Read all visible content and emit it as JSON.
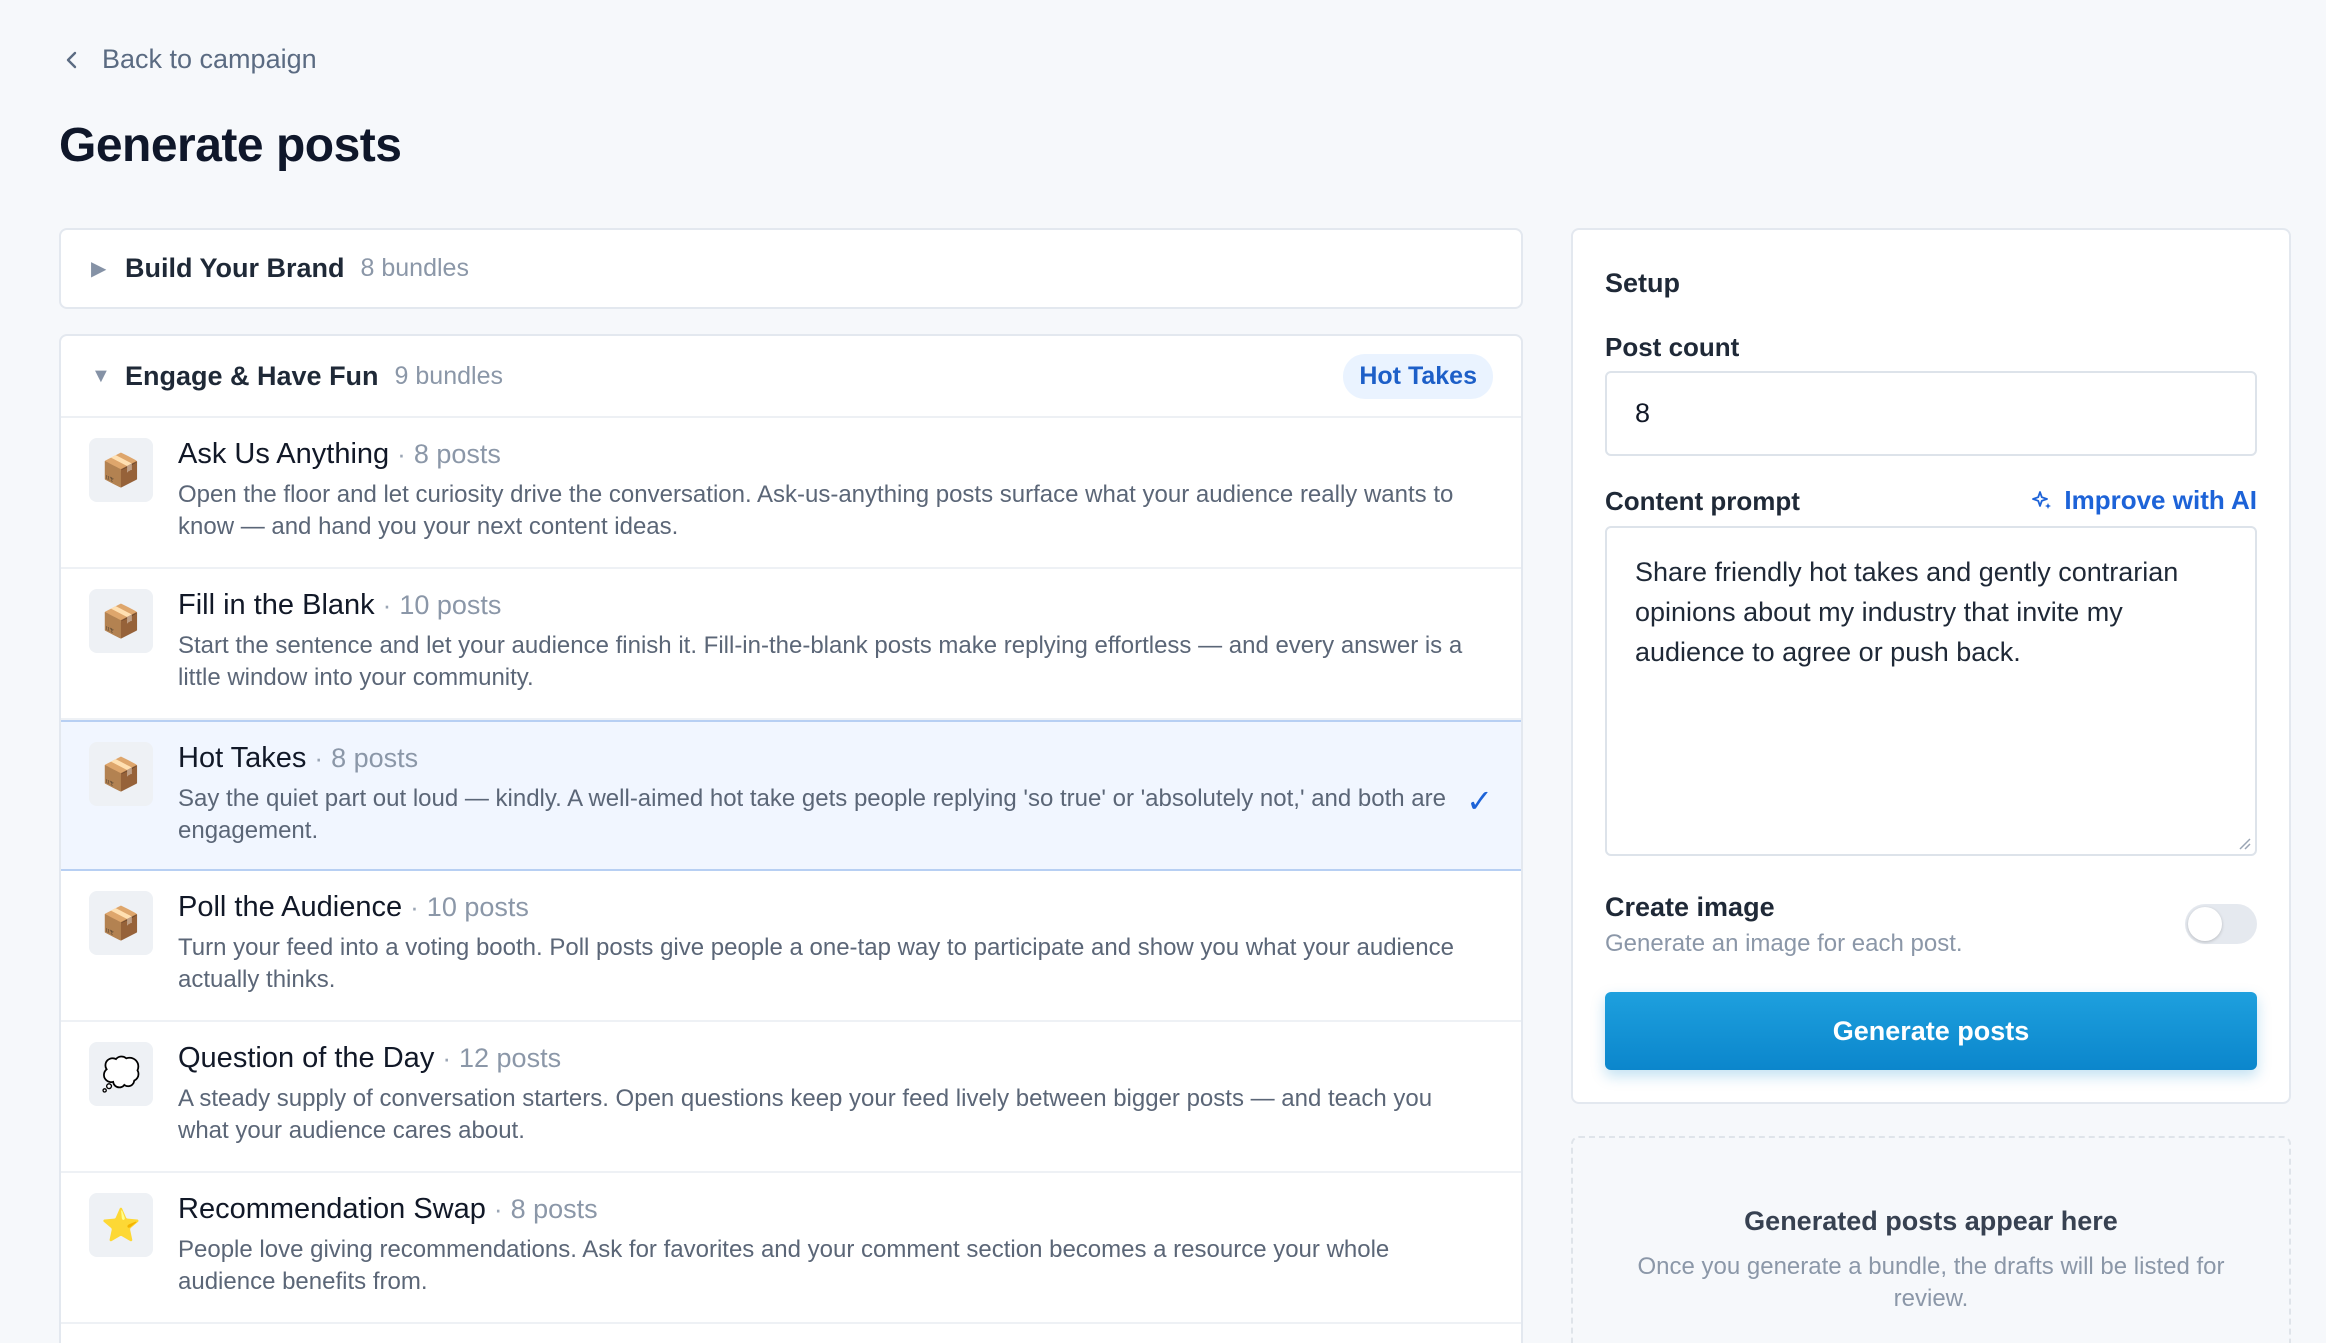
{
  "nav": {
    "back_label": "Back to campaign"
  },
  "page": {
    "title": "Generate posts"
  },
  "groups": {
    "collapsed": {
      "name": "Build Your Brand",
      "count": "8 bundles",
      "caret": "▶"
    },
    "open": {
      "name": "Engage & Have Fun",
      "count": "9 bundles",
      "caret": "▼",
      "selected_label": "Hot Takes"
    }
  },
  "bundles": [
    {
      "icon": "📦",
      "title": "Ask Us Anything",
      "sep": "·",
      "count": "8 posts",
      "desc": "Open the floor and let curiosity drive the conversation. Ask-us-anything posts surface what your audience really wants to know — and hand you your next content ideas."
    },
    {
      "icon": "📦",
      "title": "Fill in the Blank",
      "sep": "·",
      "count": "10 posts",
      "desc": "Start the sentence and let your audience finish it. Fill-in-the-blank posts make replying effortless — and every answer is a little window into your community."
    },
    {
      "icon": "📦",
      "title": "Hot Takes",
      "sep": "·",
      "count": "8 posts",
      "desc": "Say the quiet part out loud — kindly. A well-aimed hot take gets people replying 'so true' or 'absolutely not,' and both are engagement.",
      "check": "✓"
    },
    {
      "icon": "📦",
      "title": "Poll the Audience",
      "sep": "·",
      "count": "10 posts",
      "desc": "Turn your feed into a voting booth. Poll posts give people a one-tap way to participate and show you what your audience actually thinks."
    },
    {
      "icon": "💭",
      "title": "Question of the Day",
      "sep": "·",
      "count": "12 posts",
      "desc": "A steady supply of conversation starters. Open questions keep your feed lively between bigger posts — and teach you what your audience cares about."
    },
    {
      "icon": "⭐",
      "title": "Recommendation Swap",
      "sep": "·",
      "count": "8 posts",
      "desc": "People love giving recommendations. Ask for favorites and your comment section becomes a resource your whole audience benefits from."
    }
  ],
  "setup": {
    "title": "Setup",
    "post_count_label": "Post count",
    "post_count_value": "8",
    "prompt_label": "Content prompt",
    "improve_label": "Improve with AI",
    "prompt_value": "Share friendly hot takes and gently contrarian opinions about my industry that invite my audience to agree or push back.",
    "create_image_label": "Create image",
    "create_image_desc": "Generate an image for each post.",
    "create_image_on": false,
    "generate_label": "Generate posts"
  },
  "empty_state": {
    "title": "Generated posts appear here",
    "desc": "Once you generate a bundle, the drafts will be listed for review."
  },
  "colors": {
    "accent": "#1d63d8",
    "primary_button": "#0b86cc",
    "selected_bg": "#f1f6ff"
  }
}
